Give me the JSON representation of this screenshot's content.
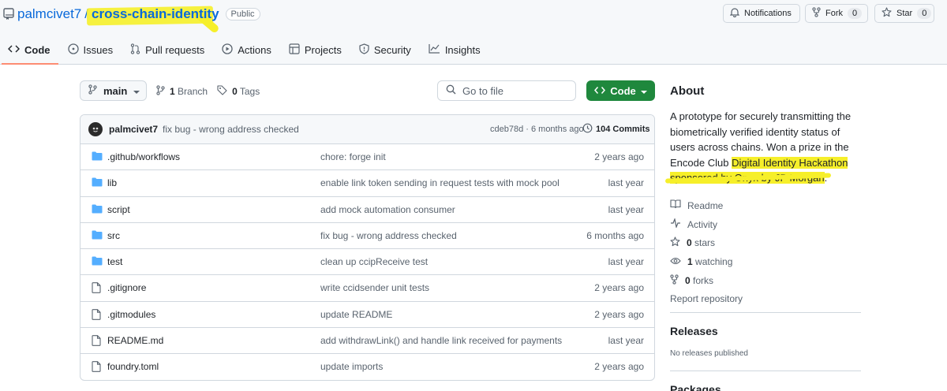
{
  "repo": {
    "owner": "palmcivet7",
    "slash": "/",
    "name": "cross-chain-identity",
    "visibility": "Public"
  },
  "header_buttons": {
    "notifications": "Notifications",
    "fork": {
      "label": "Fork",
      "count": "0"
    },
    "star": {
      "label": "Star",
      "count": "0"
    }
  },
  "tabs": [
    {
      "label": "Code",
      "icon": "code-icon"
    },
    {
      "label": "Issues",
      "icon": "issue-icon"
    },
    {
      "label": "Pull requests",
      "icon": "pull-request-icon"
    },
    {
      "label": "Actions",
      "icon": "play-icon"
    },
    {
      "label": "Projects",
      "icon": "table-icon"
    },
    {
      "label": "Security",
      "icon": "shield-icon"
    },
    {
      "label": "Insights",
      "icon": "graph-icon"
    }
  ],
  "toolbar": {
    "branch": "main",
    "branches_count": "1",
    "branches_label": "Branch",
    "tags_count": "0",
    "tags_label": "Tags",
    "search_placeholder": "Go to file",
    "code_button": "Code"
  },
  "latest_commit": {
    "author": "palmcivet7",
    "message": "fix bug - wrong address checked",
    "meta": "cdeb78d · 6 months ago",
    "count": "104 Commits"
  },
  "files": [
    {
      "type": "folder",
      "name": ".github/workflows",
      "message": "chore: forge init",
      "date": "2 years ago"
    },
    {
      "type": "folder",
      "name": "lib",
      "message": "enable link token sending in request tests with mock pool",
      "date": "last year"
    },
    {
      "type": "folder",
      "name": "script",
      "message": "add mock automation consumer",
      "date": "last year"
    },
    {
      "type": "folder",
      "name": "src",
      "message": "fix bug - wrong address checked",
      "date": "6 months ago"
    },
    {
      "type": "folder",
      "name": "test",
      "message": "clean up ccipReceive test",
      "date": "last year"
    },
    {
      "type": "file",
      "name": ".gitignore",
      "message": "write ccidsender unit tests",
      "date": "2 years ago"
    },
    {
      "type": "file",
      "name": ".gitmodules",
      "message": "update README",
      "date": "2 years ago"
    },
    {
      "type": "file",
      "name": "README.md",
      "message": "add withdrawLink() and handle link received for payments",
      "date": "last year"
    },
    {
      "type": "file",
      "name": "foundry.toml",
      "message": "update imports",
      "date": "2 years ago"
    }
  ],
  "about": {
    "heading": "About",
    "desc_plain": "A prototype for securely transmitting the biometrically verified identity status of users across chains. Won a prize in the Encode Club ",
    "desc_highlight_1": "Digital Identity Hackathon",
    "desc_highlight_2": "sponsored by Onyx by JP Morgan",
    "desc_end": ".",
    "readme": "Readme",
    "activity": "Activity",
    "stars_count": "0",
    "stars_label": "stars",
    "watching_count": "1",
    "watching_label": "watching",
    "forks_count": "0",
    "forks_label": "forks",
    "report": "Report repository"
  },
  "releases": {
    "heading": "Releases",
    "empty": "No releases published"
  },
  "packages": {
    "heading": "Packages"
  },
  "colors": {
    "accent": "#0969da",
    "highlight": "#f6ef2a",
    "code_button": "#1f883d",
    "folder": "#54aeff",
    "active_tab": "#fd8c73"
  }
}
